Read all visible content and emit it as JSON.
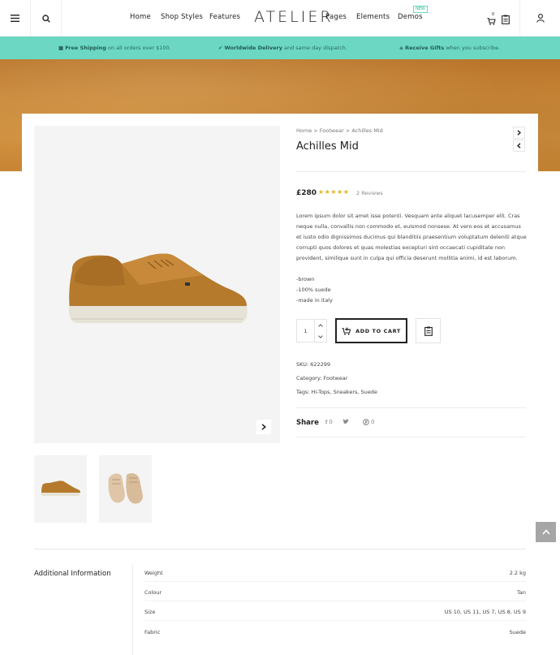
{
  "header": {
    "logo": "ATELIER",
    "nav_left": [
      "Home",
      "Shop Styles",
      "Features"
    ],
    "nav_right": [
      "Pages",
      "Elements",
      "Demos"
    ],
    "new_badge": "NEW",
    "cart_count": "0"
  },
  "topbar": {
    "shipping_bold": "Free Shipping",
    "shipping_rest": " on all orders over $100.",
    "delivery_bold": "Worldwide Delivery",
    "delivery_rest": " and same day dispatch.",
    "gifts_bold": "Receive Gifts",
    "gifts_rest": " when you subscribe."
  },
  "product": {
    "breadcrumb": "Home > Footwear > Achilles Mid",
    "title": "Achilles Mid",
    "price": "£280",
    "stars": "★★★★★",
    "reviews": "2 Reviews",
    "description": "Lorem ipsum dolor sit amet isse potenti. Vesquam ante aliquet lacusemper elit. Cras neque nulla, convallis non commodo et, euismod nonsese. At vero eos et accusamus et iusto odio dignissimos ducimus qui blanditiis praesentium voluptatum deleniti atque corrupti quos dolores et quas molestias excepturi sint occaecati cupiditate non provident, similique sunt in culpa qui officia deserunt mollitia animi, id est laborum.",
    "bullets": [
      "-brown",
      "-100% suede",
      "-made in italy"
    ],
    "quantity": "1",
    "add_to_cart": "ADD TO CART",
    "sku": "SKU: 622299",
    "category": "Category: Footwear",
    "tags": "Tags: Hi-Tops, Sneakers, Suede",
    "share_label": "Share",
    "facebook_count": "0",
    "pinterest_count": "0"
  },
  "additional": {
    "title": "Additional Information",
    "rows": [
      {
        "k": "Weight",
        "v": "2.2 kg"
      },
      {
        "k": "Colour",
        "v": "Tan"
      },
      {
        "k": "Size",
        "v": "US 10, US 11, US 7, US 8, US 9"
      },
      {
        "k": "Fabric",
        "v": "Suede"
      }
    ]
  },
  "colors": {
    "accent": "#6cd8c3",
    "star": "#e5b61b",
    "hero": "#c88637"
  }
}
